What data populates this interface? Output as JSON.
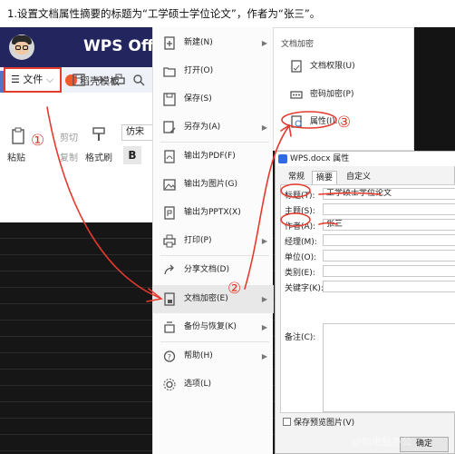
{
  "instruction": "1.设置文档属性摘要的标题为“工学硕士学位论文”，作者为“张三”。",
  "app": {
    "title": "WPS Offi",
    "tabs": {
      "home": "首页",
      "template": "稻壳模板"
    },
    "file_button": "文件",
    "ribbon": {
      "paste": "粘贴",
      "cut": "剪切",
      "copy": "复制",
      "format_painter": "格式刷",
      "font_name": "仿宋",
      "bold": "B"
    }
  },
  "file_menu": {
    "items": [
      {
        "label": "新建(N)",
        "icon": "new-icon",
        "has_submenu": true
      },
      {
        "label": "打开(O)",
        "icon": "folder-icon",
        "has_submenu": false
      },
      {
        "label": "保存(S)",
        "icon": "save-icon",
        "has_submenu": false
      },
      {
        "label": "另存为(A)",
        "icon": "save-as-icon",
        "has_submenu": true
      },
      {
        "label": "输出为PDF(F)",
        "icon": "pdf-icon",
        "has_submenu": false
      },
      {
        "label": "输出为图片(G)",
        "icon": "image-icon",
        "has_submenu": false
      },
      {
        "label": "输出为PPTX(X)",
        "icon": "pptx-icon",
        "has_submenu": false
      },
      {
        "label": "打印(P)",
        "icon": "print-icon",
        "has_submenu": true
      },
      {
        "label": "分享文档(D)",
        "icon": "share-icon",
        "has_submenu": false
      },
      {
        "label": "文档加密(E)",
        "icon": "encrypt-icon",
        "has_submenu": true
      },
      {
        "label": "备份与恢复(K)",
        "icon": "backup-icon",
        "has_submenu": true
      },
      {
        "label": "帮助(H)",
        "icon": "help-icon",
        "has_submenu": true
      },
      {
        "label": "选项(L)",
        "icon": "options-icon",
        "has_submenu": false
      }
    ]
  },
  "submenu": {
    "title": "文档加密",
    "items": [
      {
        "label": "文档权限(U)",
        "icon": "permission-icon"
      },
      {
        "label": "密码加密(P)",
        "icon": "password-icon"
      },
      {
        "label": "属性(I)...",
        "icon": "properties-icon"
      }
    ]
  },
  "dialog": {
    "title": "WPS.docx 属性",
    "tabs": [
      "常规",
      "摘要",
      "自定义"
    ],
    "fields": [
      {
        "label": "标题(T):",
        "value": "工学硕士学位论文"
      },
      {
        "label": "主题(S):",
        "value": ""
      },
      {
        "label": "作者(A):",
        "value": "张三"
      },
      {
        "label": "经理(M):",
        "value": ""
      },
      {
        "label": "单位(O):",
        "value": ""
      },
      {
        "label": "类别(E):",
        "value": ""
      },
      {
        "label": "关键字(K):",
        "value": ""
      },
      {
        "label": "备注(C):",
        "value": ""
      }
    ],
    "save_preview": "保存预览图片(V)",
    "ok": "确定"
  },
  "annotations": {
    "step1": "①",
    "step2": "②",
    "step3": "③"
  },
  "watermark": "@新电脑办公",
  "colors": {
    "annotation_red": "#e53a2e",
    "title_bar": "#23255e",
    "tab_active": "#4f74c8"
  }
}
